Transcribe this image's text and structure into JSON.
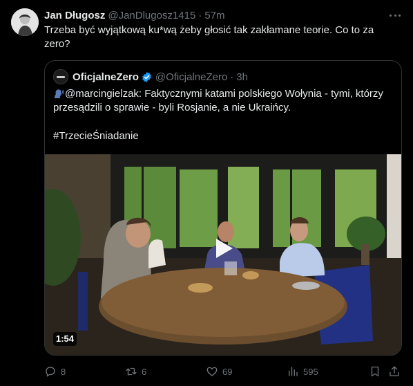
{
  "tweet": {
    "author_name": "Jan Długosz",
    "author_handle": "@JanDlugosz1415",
    "separator": "·",
    "time": "57m",
    "text": "Trzeba być wyjątkową ku*wą żeby głosić tak zakłamane teorie. Co to za zero?"
  },
  "quote": {
    "author_name": "OficjalneZero",
    "author_handle": "@OficjalneZero",
    "separator": "·",
    "time": "3h",
    "text": "@marcingielzak: Faktycznymi katami polskiego Wołynia - tymi, którzy przesądzili o sprawie - byli Rosjanie, a nie Ukraińcy.",
    "hashtag": "#TrzecieŚniadanie",
    "video": {
      "duration": "1:54"
    }
  },
  "actions": {
    "replies": "8",
    "retweets": "6",
    "likes": "69",
    "views": "595"
  },
  "icons": [
    "avatar",
    "more-icon",
    "verified-badge-icon",
    "speaking-head-icon",
    "play-icon",
    "reply-icon",
    "retweet-icon",
    "like-icon",
    "views-icon",
    "bookmark-icon",
    "share-icon"
  ],
  "colors": {
    "background": "#000000",
    "text": "#e7e9ea",
    "muted": "#71767b",
    "border": "#2f3336",
    "verified": "#1d9bf0"
  }
}
